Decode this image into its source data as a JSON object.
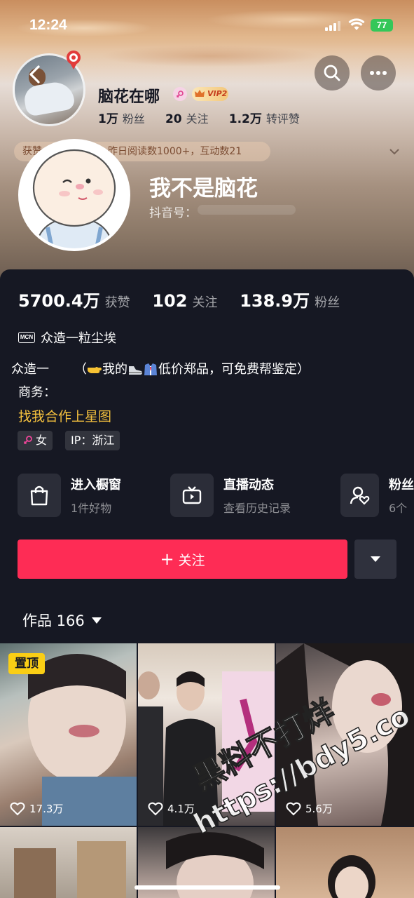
{
  "status_bar": {
    "time": "12:24",
    "battery": "77"
  },
  "header": {
    "name": "脑花在哪",
    "vip": "VIP2",
    "stats": [
      {
        "value": "1万",
        "label": "粉丝"
      },
      {
        "value": "20",
        "label": "关注"
      },
      {
        "value": "1.2万",
        "label": "转评赞"
      }
    ],
    "notice_prefix": "获赞",
    "notice_text": "昨日阅读数1000+，互动数21"
  },
  "profile": {
    "nickname": "我不是脑花",
    "douyin_id_label": "抖音号："
  },
  "stats": [
    {
      "value": "5700.4万",
      "label": "获赞"
    },
    {
      "value": "102",
      "label": "关注"
    },
    {
      "value": "138.9万",
      "label": "粉丝"
    }
  ],
  "mcn": {
    "icon_text": "MCN",
    "name": "众造一粒尘埃"
  },
  "bio": {
    "line1_start": "众造一",
    "line1_paren_open": "（",
    "line1_mid": "我的",
    "line1_end": "低价郑品，可免费帮鉴定）",
    "line2": "商务：",
    "line3": "找我合作上星图"
  },
  "tags": {
    "gender": "女",
    "ip": "IP：浙江"
  },
  "features": [
    {
      "title": "进入橱窗",
      "sub": "1件好物",
      "icon": "shopping-bag-icon"
    },
    {
      "title": "直播动态",
      "sub": "查看历史记录",
      "icon": "tv-icon"
    },
    {
      "title": "粉丝",
      "sub": "6个",
      "icon": "fan-heart-icon"
    }
  ],
  "follow_button": "关注",
  "works": {
    "label": "作品 166"
  },
  "videos": [
    {
      "likes": "17.3万",
      "pinned": "置顶"
    },
    {
      "likes": "4.1万"
    },
    {
      "likes": "5.6万"
    }
  ],
  "watermark": {
    "line1": "黑料不打烊",
    "line2": "https://bdy5.co"
  },
  "colors": {
    "accent": "#fe2c55",
    "background": "#161823",
    "link_yellow": "#f5c13e",
    "pin_yellow": "#face15"
  }
}
